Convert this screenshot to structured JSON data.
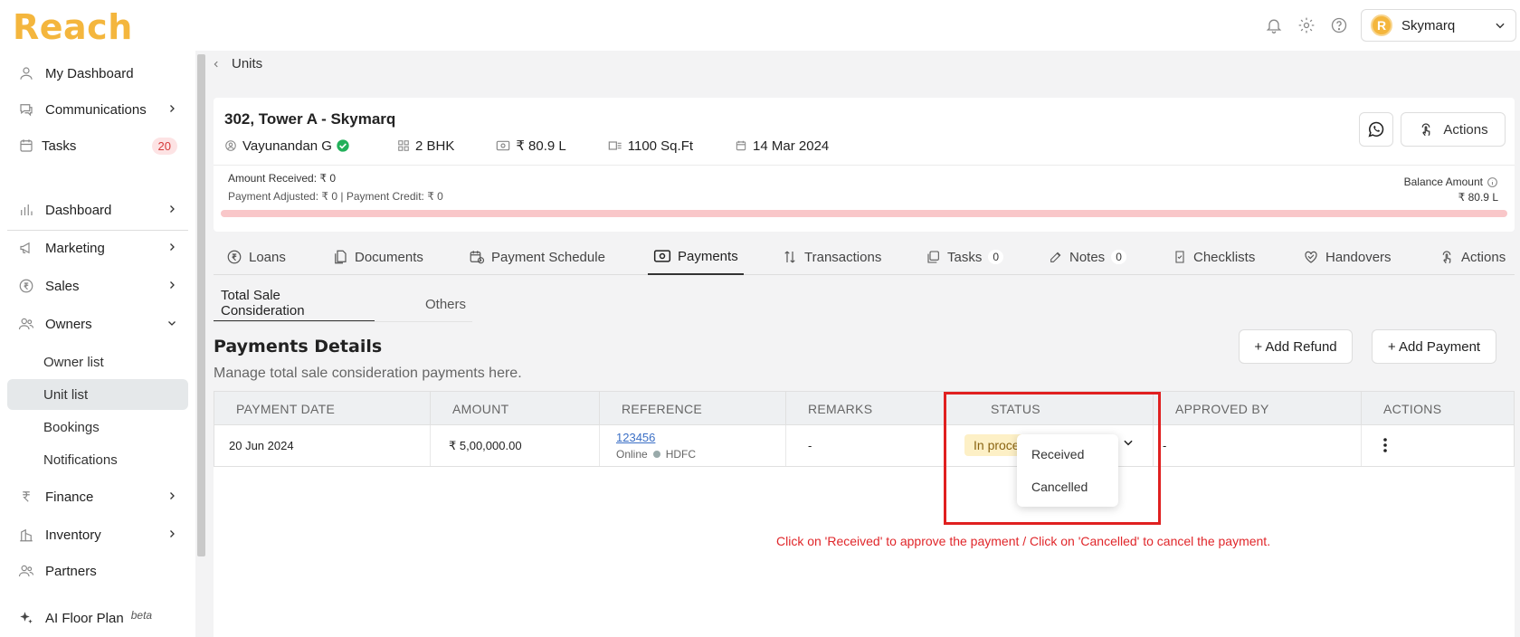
{
  "app": {
    "logo": "Reach",
    "org_initial": "R",
    "org_name": "Skymarq"
  },
  "sidebar": {
    "items": [
      {
        "label": "My Dashboard"
      },
      {
        "label": "Communications"
      },
      {
        "label": "Tasks",
        "badge": "20"
      },
      {
        "label": "Dashboard"
      },
      {
        "label": "Marketing"
      },
      {
        "label": "Sales"
      },
      {
        "label": "Owners"
      },
      {
        "label": "Finance"
      },
      {
        "label": "Inventory"
      },
      {
        "label": "Partners"
      },
      {
        "label": "AI Floor Plan",
        "tag": "beta"
      }
    ],
    "owners_sub": [
      "Owner list",
      "Unit list",
      "Bookings",
      "Notifications"
    ]
  },
  "breadcrumb": {
    "label": "Units"
  },
  "unit": {
    "title": "302, Tower A - Skymarq",
    "owner": "Vayunandan G",
    "config": "2 BHK",
    "price": "₹ 80.9 L",
    "area": "1100 Sq.Ft",
    "date": "14 Mar 2024",
    "actions_label": "Actions",
    "amount_received": "Amount Received: ₹ 0",
    "amount_adjusted": "Payment Adjusted: ₹ 0 | Payment Credit: ₹ 0",
    "balance_label": "Balance Amount",
    "balance_value": "₹ 80.9 L",
    "paid_fraction": 0
  },
  "tabs": [
    {
      "label": "Loans"
    },
    {
      "label": "Documents"
    },
    {
      "label": "Payment Schedule"
    },
    {
      "label": "Payments",
      "active": true
    },
    {
      "label": "Transactions"
    },
    {
      "label": "Tasks",
      "count": "0"
    },
    {
      "label": "Notes",
      "count": "0"
    },
    {
      "label": "Checklists"
    },
    {
      "label": "Handovers"
    },
    {
      "label": "Actions"
    }
  ],
  "subtabs": [
    "Total Sale Consideration",
    "Others"
  ],
  "payments": {
    "title": "Payments Details",
    "subtitle": "Manage total sale consideration payments here.",
    "add_refund": "+ Add Refund",
    "add_payment": "+ Add Payment",
    "columns": [
      "PAYMENT DATE",
      "AMOUNT",
      "REFERENCE",
      "REMARKS",
      "STATUS",
      "APPROVED BY",
      "ACTIONS"
    ],
    "rows": [
      {
        "date": "20 Jun 2024",
        "amount": "₹ 5,00,000.00",
        "reference": "123456",
        "mode": "Online",
        "bank": "HDFC",
        "remarks": "-",
        "status": "In process",
        "approved_by": "-"
      }
    ],
    "status_options": [
      "Received",
      "Cancelled"
    ]
  },
  "annotation": "Click on 'Received' to approve the payment / Click on 'Cancelled' to cancel the payment.",
  "colors": {
    "brand": "#f4b63d",
    "highlight": "#e02020",
    "progress_bg": "#f9c7c9"
  }
}
